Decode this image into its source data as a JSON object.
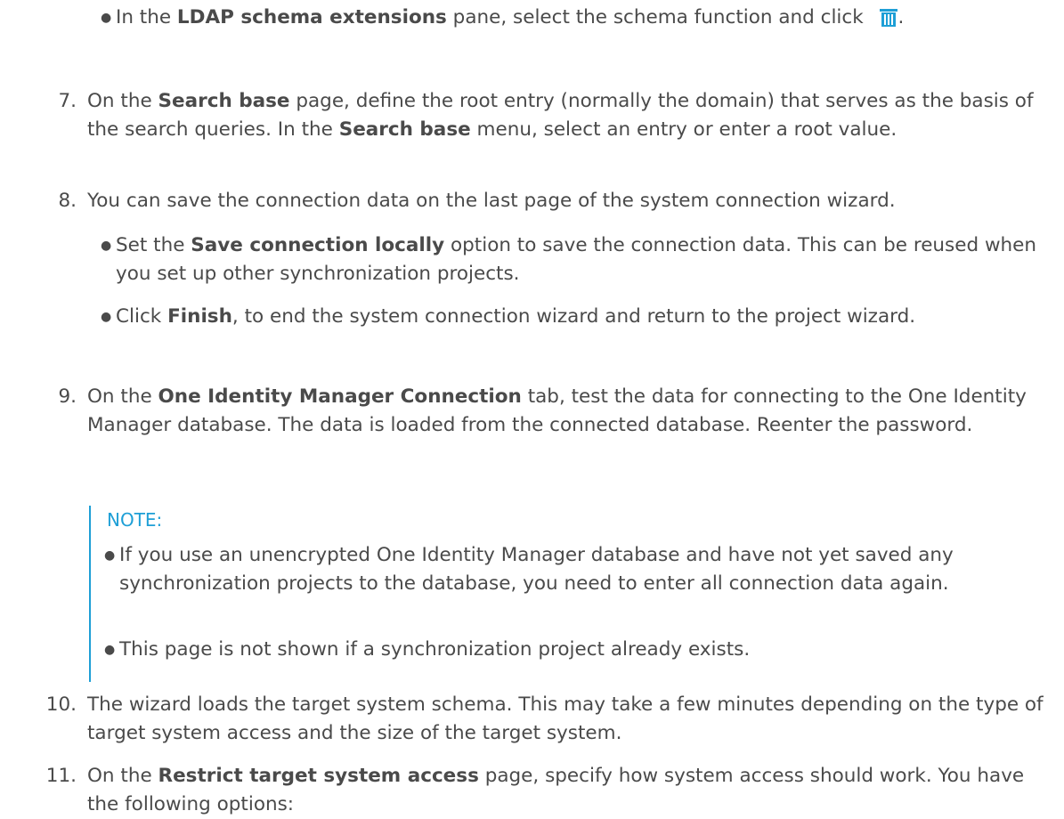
{
  "bullet_delete": {
    "pre": "In the ",
    "bold": "LDAP schema extensions",
    "post": " pane, select the schema function and click ",
    "end": ".",
    "icon": "trash-icon",
    "icon_color": "#1e9fd6"
  },
  "steps": [
    {
      "num": "7.",
      "parts": [
        {
          "t": "On the "
        },
        {
          "b": "Search base"
        },
        {
          "t": " page, define the root entry (normally the domain) that serves as the basis of the search queries. In the "
        },
        {
          "b": "Search base"
        },
        {
          "t": " menu, select an entry or enter a root value."
        }
      ]
    },
    {
      "num": "8.",
      "parts": [
        {
          "t": "You can save the connection data on the last page of the system connection wizard."
        }
      ]
    },
    {
      "num": "9.",
      "parts": [
        {
          "t": "On the "
        },
        {
          "b": "One Identity Manager Connection"
        },
        {
          "t": " tab, test the data for connecting to the One Identity Manager database. The data is loaded from the connected database. Reenter the password."
        }
      ]
    },
    {
      "num": "10.",
      "parts": [
        {
          "t": "The wizard loads the target system schema. This may take a few minutes depending on the type of target system access and the size of the target system."
        }
      ]
    },
    {
      "num": "11.",
      "parts": [
        {
          "t": "On the "
        },
        {
          "b": "Restrict target system access"
        },
        {
          "t": " page, specify how system access should work. You have the following options:"
        }
      ]
    }
  ],
  "step8_bullets": [
    {
      "parts": [
        {
          "t": "Set the "
        },
        {
          "b": "Save connection locally"
        },
        {
          "t": " option to save the connection data. This can be reused when you set up other synchronization projects."
        }
      ]
    },
    {
      "parts": [
        {
          "t": "Click "
        },
        {
          "b": "Finish"
        },
        {
          "t": ", to end the system connection wizard and return to the project wizard."
        }
      ]
    }
  ],
  "note": {
    "label": "NOTE:",
    "items": [
      "If you use an unencrypted One Identity Manager database and have not yet saved any synchronization projects to the database, you need to enter all connection data again.",
      "This page is not shown if a synchronization project already exists."
    ],
    "accent_color": "#1e9fd6"
  }
}
